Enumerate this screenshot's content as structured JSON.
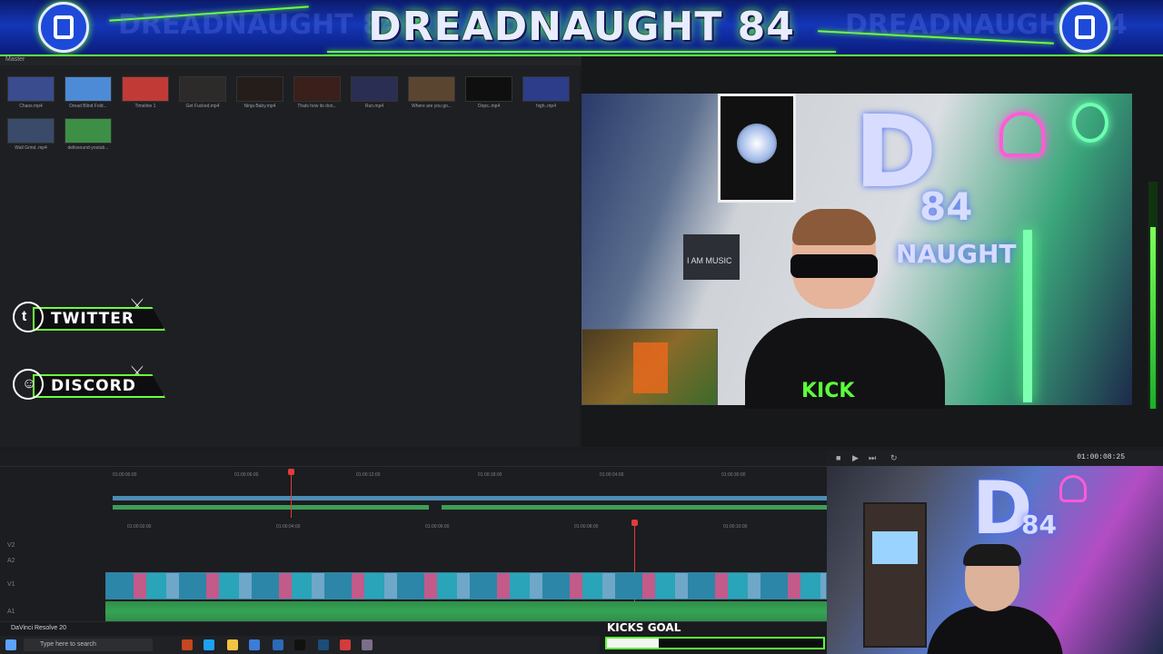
{
  "banner": {
    "title": "DREADNAUGHT 84",
    "ghost_text": "DREADNAUGHT 84"
  },
  "editor": {
    "master_label": "Master",
    "clips": [
      {
        "name": "Chaos.mp4",
        "color": "#3a4c8e"
      },
      {
        "name": "Dread Blind Fold...",
        "color": "#4d8bd6"
      },
      {
        "name": "Timeline 1",
        "color": "#c13a36"
      },
      {
        "name": "Get Fucked.mp4",
        "color": "#2d2a2a"
      },
      {
        "name": "Ninja Baby.mp4",
        "color": "#241d1a"
      },
      {
        "name": "Thats how its don...",
        "color": "#3a1f1a"
      },
      {
        "name": "Run.mp4",
        "color": "#2a2e52"
      },
      {
        "name": "Where are you go...",
        "color": "#5a4630"
      },
      {
        "name": "Oops..mp4",
        "color": "#0f0f10"
      },
      {
        "name": "high..mp4",
        "color": "#2d3d8a"
      },
      {
        "name": "Wall Grind..mp4",
        "color": "#3a4a6a"
      },
      {
        "name": "dellosound-youtub...",
        "color": "#3d8f45"
      }
    ],
    "app_name": "DaVinci Resolve 20"
  },
  "socials": [
    {
      "label": "TWITTER",
      "color": "#1d9bf0",
      "icon": "twitter-bird-icon"
    },
    {
      "label": "DISCORD",
      "color": "#5865f2",
      "icon": "discord-icon"
    }
  ],
  "viewer": {
    "timecode": "01:00:08:25",
    "wall_sign": "I AM MUSIC",
    "wall_number": "84",
    "wall_word": "NAUGHT",
    "shirt_text": "KICK"
  },
  "timeline": {
    "ruler_top": [
      "01:00:00:00",
      "01:00:06:00",
      "01:00:12:00",
      "01:00:18:00",
      "01:00:24:00",
      "01:00:30:00"
    ],
    "ruler_bottom": [
      "01:00:02:00",
      "01:00:04:00",
      "01:00:06:00",
      "01:00:08:00",
      "01:00:10:00"
    ],
    "track_labels": [
      "V2",
      "A2",
      "V1",
      "A1"
    ]
  },
  "goal": {
    "label": "KICKS GOAL",
    "progress": 0.24
  },
  "taskbar": {
    "search_placeholder": "Type here to search"
  },
  "colors": {
    "neon_green": "#5cff3a",
    "banner_blue": "#1436b8",
    "playhead": "#e23b3b"
  }
}
